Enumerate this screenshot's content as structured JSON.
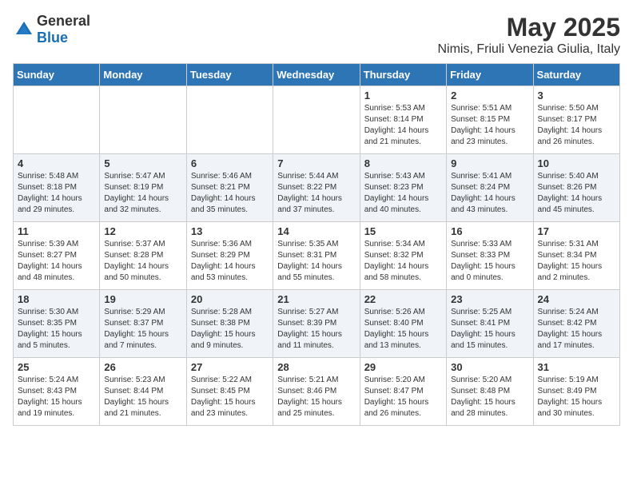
{
  "header": {
    "logo_general": "General",
    "logo_blue": "Blue",
    "month_title": "May 2025",
    "location": "Nimis, Friuli Venezia Giulia, Italy"
  },
  "weekdays": [
    "Sunday",
    "Monday",
    "Tuesday",
    "Wednesday",
    "Thursday",
    "Friday",
    "Saturday"
  ],
  "weeks": [
    [
      {
        "day": "",
        "sunrise": "",
        "sunset": "",
        "daylight": ""
      },
      {
        "day": "",
        "sunrise": "",
        "sunset": "",
        "daylight": ""
      },
      {
        "day": "",
        "sunrise": "",
        "sunset": "",
        "daylight": ""
      },
      {
        "day": "",
        "sunrise": "",
        "sunset": "",
        "daylight": ""
      },
      {
        "day": "1",
        "sunrise": "5:53 AM",
        "sunset": "8:14 PM",
        "daylight": "14 hours and 21 minutes."
      },
      {
        "day": "2",
        "sunrise": "5:51 AM",
        "sunset": "8:15 PM",
        "daylight": "14 hours and 23 minutes."
      },
      {
        "day": "3",
        "sunrise": "5:50 AM",
        "sunset": "8:17 PM",
        "daylight": "14 hours and 26 minutes."
      }
    ],
    [
      {
        "day": "4",
        "sunrise": "5:48 AM",
        "sunset": "8:18 PM",
        "daylight": "14 hours and 29 minutes."
      },
      {
        "day": "5",
        "sunrise": "5:47 AM",
        "sunset": "8:19 PM",
        "daylight": "14 hours and 32 minutes."
      },
      {
        "day": "6",
        "sunrise": "5:46 AM",
        "sunset": "8:21 PM",
        "daylight": "14 hours and 35 minutes."
      },
      {
        "day": "7",
        "sunrise": "5:44 AM",
        "sunset": "8:22 PM",
        "daylight": "14 hours and 37 minutes."
      },
      {
        "day": "8",
        "sunrise": "5:43 AM",
        "sunset": "8:23 PM",
        "daylight": "14 hours and 40 minutes."
      },
      {
        "day": "9",
        "sunrise": "5:41 AM",
        "sunset": "8:24 PM",
        "daylight": "14 hours and 43 minutes."
      },
      {
        "day": "10",
        "sunrise": "5:40 AM",
        "sunset": "8:26 PM",
        "daylight": "14 hours and 45 minutes."
      }
    ],
    [
      {
        "day": "11",
        "sunrise": "5:39 AM",
        "sunset": "8:27 PM",
        "daylight": "14 hours and 48 minutes."
      },
      {
        "day": "12",
        "sunrise": "5:37 AM",
        "sunset": "8:28 PM",
        "daylight": "14 hours and 50 minutes."
      },
      {
        "day": "13",
        "sunrise": "5:36 AM",
        "sunset": "8:29 PM",
        "daylight": "14 hours and 53 minutes."
      },
      {
        "day": "14",
        "sunrise": "5:35 AM",
        "sunset": "8:31 PM",
        "daylight": "14 hours and 55 minutes."
      },
      {
        "day": "15",
        "sunrise": "5:34 AM",
        "sunset": "8:32 PM",
        "daylight": "14 hours and 58 minutes."
      },
      {
        "day": "16",
        "sunrise": "5:33 AM",
        "sunset": "8:33 PM",
        "daylight": "15 hours and 0 minutes."
      },
      {
        "day": "17",
        "sunrise": "5:31 AM",
        "sunset": "8:34 PM",
        "daylight": "15 hours and 2 minutes."
      }
    ],
    [
      {
        "day": "18",
        "sunrise": "5:30 AM",
        "sunset": "8:35 PM",
        "daylight": "15 hours and 5 minutes."
      },
      {
        "day": "19",
        "sunrise": "5:29 AM",
        "sunset": "8:37 PM",
        "daylight": "15 hours and 7 minutes."
      },
      {
        "day": "20",
        "sunrise": "5:28 AM",
        "sunset": "8:38 PM",
        "daylight": "15 hours and 9 minutes."
      },
      {
        "day": "21",
        "sunrise": "5:27 AM",
        "sunset": "8:39 PM",
        "daylight": "15 hours and 11 minutes."
      },
      {
        "day": "22",
        "sunrise": "5:26 AM",
        "sunset": "8:40 PM",
        "daylight": "15 hours and 13 minutes."
      },
      {
        "day": "23",
        "sunrise": "5:25 AM",
        "sunset": "8:41 PM",
        "daylight": "15 hours and 15 minutes."
      },
      {
        "day": "24",
        "sunrise": "5:24 AM",
        "sunset": "8:42 PM",
        "daylight": "15 hours and 17 minutes."
      }
    ],
    [
      {
        "day": "25",
        "sunrise": "5:24 AM",
        "sunset": "8:43 PM",
        "daylight": "15 hours and 19 minutes."
      },
      {
        "day": "26",
        "sunrise": "5:23 AM",
        "sunset": "8:44 PM",
        "daylight": "15 hours and 21 minutes."
      },
      {
        "day": "27",
        "sunrise": "5:22 AM",
        "sunset": "8:45 PM",
        "daylight": "15 hours and 23 minutes."
      },
      {
        "day": "28",
        "sunrise": "5:21 AM",
        "sunset": "8:46 PM",
        "daylight": "15 hours and 25 minutes."
      },
      {
        "day": "29",
        "sunrise": "5:20 AM",
        "sunset": "8:47 PM",
        "daylight": "15 hours and 26 minutes."
      },
      {
        "day": "30",
        "sunrise": "5:20 AM",
        "sunset": "8:48 PM",
        "daylight": "15 hours and 28 minutes."
      },
      {
        "day": "31",
        "sunrise": "5:19 AM",
        "sunset": "8:49 PM",
        "daylight": "15 hours and 30 minutes."
      }
    ]
  ]
}
